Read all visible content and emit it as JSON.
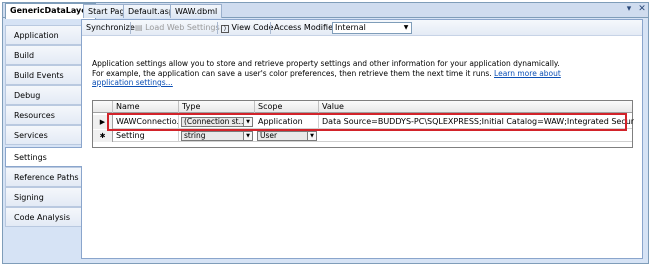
{
  "tabs": [
    {
      "label": "GenericDataLayer",
      "active": true
    },
    {
      "label": "Start Page"
    },
    {
      "label": "Default.aspx"
    },
    {
      "label": "WAW.dbml"
    }
  ],
  "window_controls": {
    "pin": "▾",
    "close": "✕"
  },
  "sidebar": {
    "items": [
      {
        "label": "Application"
      },
      {
        "label": "Build"
      },
      {
        "label": "Build Events"
      },
      {
        "label": "Debug"
      },
      {
        "label": "Resources"
      },
      {
        "label": "Services"
      },
      {
        "label": "Settings",
        "active": true
      },
      {
        "label": "Reference Paths"
      },
      {
        "label": "Signing"
      },
      {
        "label": "Code Analysis"
      }
    ]
  },
  "toolbar": {
    "synchronize": "Synchronize",
    "load_web_settings": "Load Web Settings",
    "view_code": "View Code",
    "access_modifier_label": "Access Modifier:",
    "access_modifier_value": "Internal"
  },
  "description": {
    "text": "Application settings allow you to store and retrieve property settings and other information for your application dynamically. For example, the application can save a user's color preferences, then retrieve them the next time it runs.",
    "link": "Learn more about application settings..."
  },
  "grid": {
    "columns": [
      "Name",
      "Type",
      "Scope",
      "Value"
    ],
    "rows": [
      {
        "marker": "▶",
        "name": "WAWConnectio...",
        "type": "(Connection st...",
        "scope": "Application",
        "value": "Data Source=BUDDYS-PC\\SQLEXPRESS;Initial Catalog=WAW;Integrated Security=True"
      },
      {
        "marker": "✱",
        "name": "Setting",
        "type": "string",
        "scope": "User",
        "value": ""
      }
    ]
  },
  "colors": {
    "highlight": "#d2232a",
    "link": "#0b4fb5",
    "frame": "#d6e3f5"
  }
}
